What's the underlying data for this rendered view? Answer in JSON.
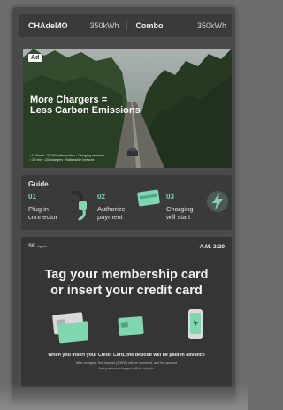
{
  "header": {
    "left": {
      "name": "CHAdeMO",
      "power": "350kWh"
    },
    "right": {
      "name": "Combo",
      "power": "350kWh"
    }
  },
  "ad": {
    "badge": "Ad",
    "title_lines": [
      "More Chargers =",
      "Less Carbon Emissions"
    ],
    "fine_print": [
      "• In Seoul · 20,000 hallway sites · Charging networks",
      "• 30 min · 125 chargers · Nationwide Network"
    ]
  },
  "guide": {
    "title": "Guide",
    "steps": [
      {
        "num": "01",
        "label_lines": [
          "Plug in",
          "connector"
        ],
        "icon": "plug-icon"
      },
      {
        "num": "02",
        "label_lines": [
          "Authorize",
          "payment"
        ],
        "icon": "credit-card-icon"
      },
      {
        "num": "03",
        "label_lines": [
          "Charging",
          "will start"
        ],
        "icon": "lightning-icon"
      }
    ]
  },
  "main": {
    "brand": "SK",
    "brand_sub": "signet",
    "time": "A.M. 2:29",
    "headline_lines": [
      "Tag your membership card",
      "or insert your credit card"
    ],
    "methods": [
      "membership-card-icon",
      "credit-card-icon",
      "mobile-phone-icon"
    ],
    "note": "When you insert your Credit Card, the deposit will be paid in advance",
    "fine_lines": [
      "After charging, the deposit (20000) will be canceled, and the amount",
      "that you have charged will be re-paid."
    ]
  },
  "colors": {
    "accent": "#7fd7b1",
    "panel": "#3a3a3a",
    "background": "#6c6c6c"
  }
}
